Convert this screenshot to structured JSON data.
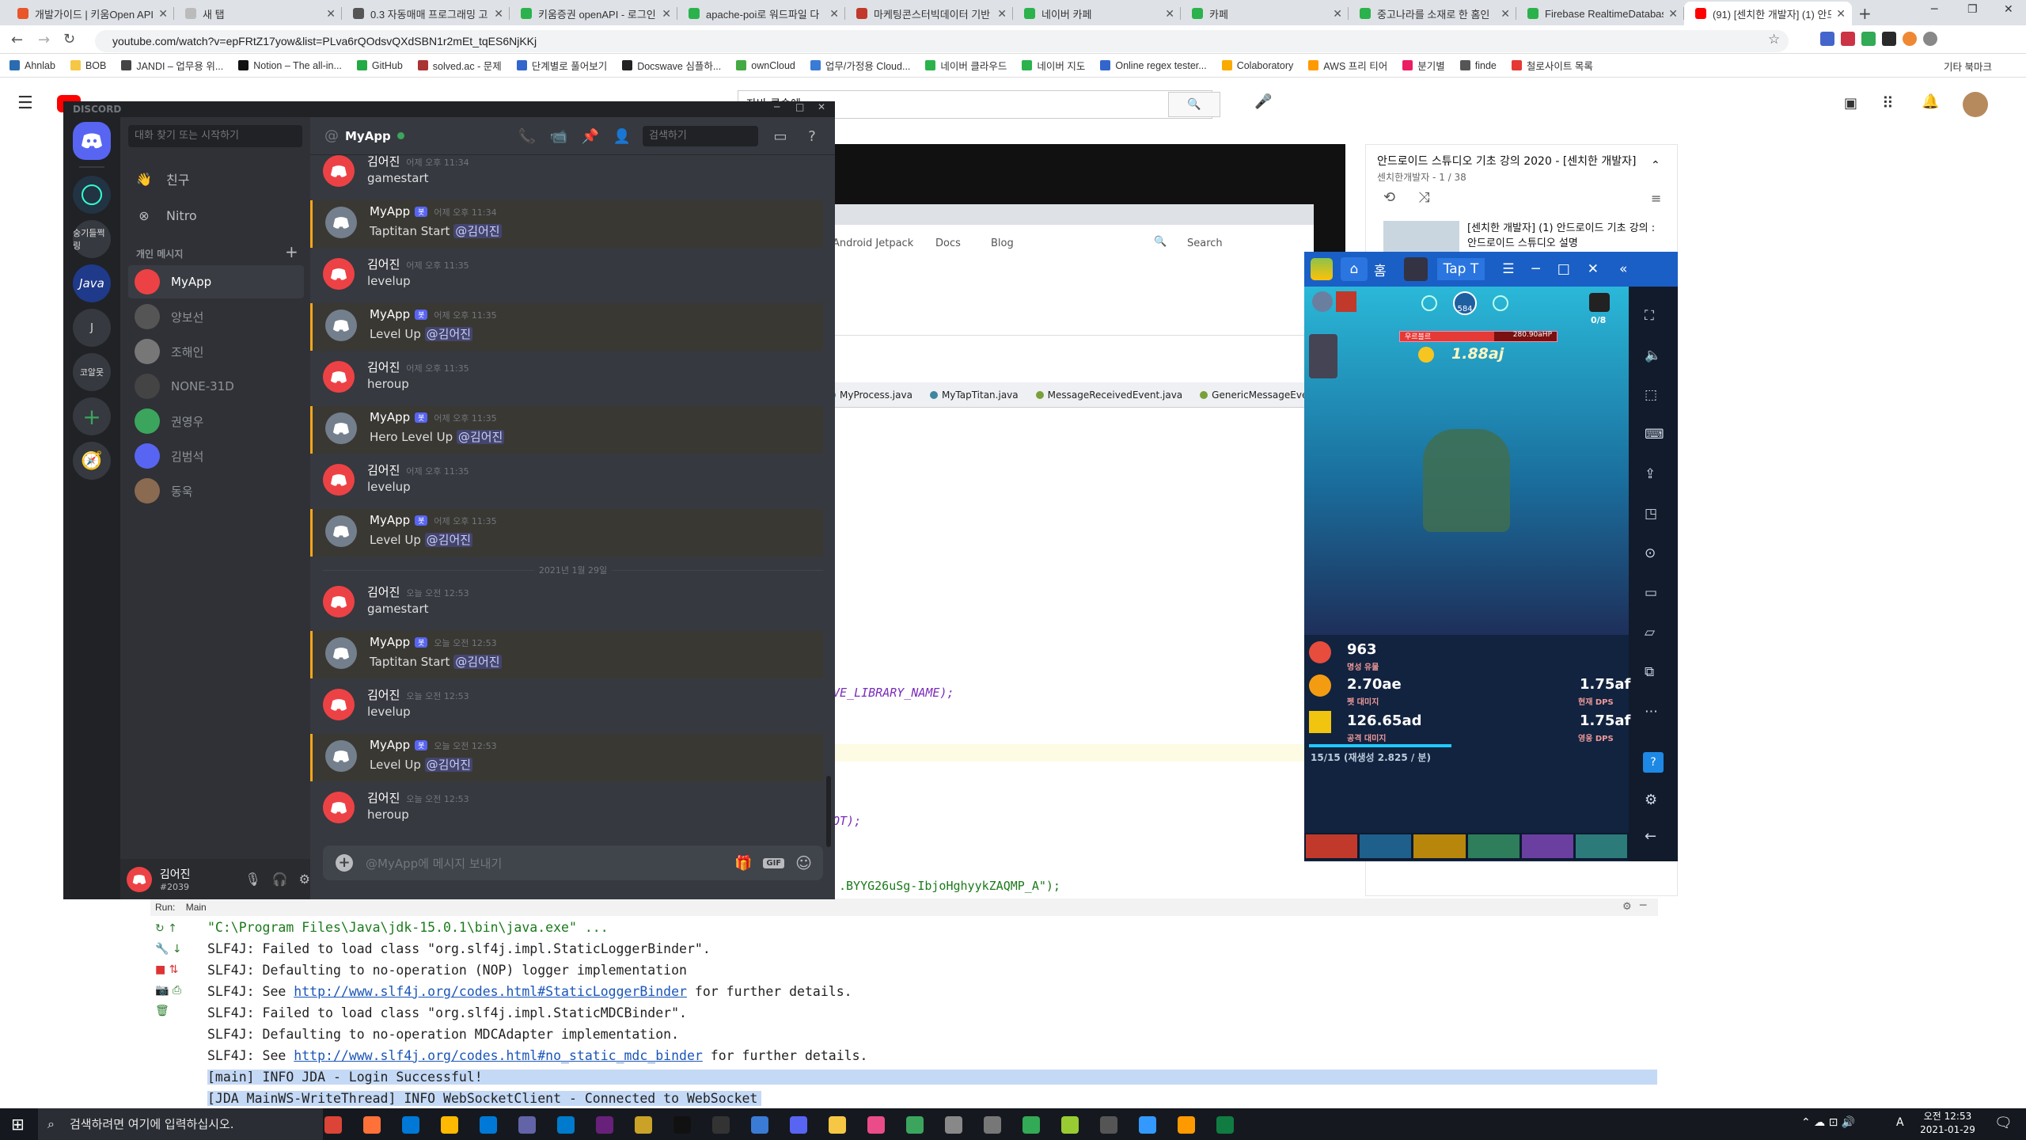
{
  "chrome": {
    "tabs": [
      {
        "title": "개발가이드 | 키움Open API",
        "color": "#e8562a",
        "active": false
      },
      {
        "title": "새 탭",
        "color": "#bbbbbb",
        "active": false
      },
      {
        "title": "0.3 자동매매 프로그래밍 고",
        "color": "#555555",
        "active": false
      },
      {
        "title": "키움증권 openAPI - 로그인",
        "color": "#2bb24c",
        "active": false
      },
      {
        "title": "apache-poi로 워드파일 다",
        "color": "#2bb24c",
        "active": false
      },
      {
        "title": "마케팅콘스터빅데이터 기반",
        "color": "#c0392b",
        "active": false
      },
      {
        "title": "네이버 카페",
        "color": "#2bb24c",
        "active": false
      },
      {
        "title": "카페",
        "color": "#2bb24c",
        "active": false
      },
      {
        "title": "중고나라를 소재로 한 홈인",
        "color": "#2bb24c",
        "active": false
      },
      {
        "title": "Firebase RealtimeDatabase",
        "color": "#2bb24c",
        "active": false
      },
      {
        "title": "(91) [센치한 개발자] (1) 안드",
        "color": "#ff0000",
        "active": true
      }
    ],
    "url": "youtube.com/watch?v=epFRtZ17yow&list=PLva6rQOdsvQXdSBN1r2mEt_tqES6NjKKj",
    "bookmarks": [
      "Ahnlab",
      "BOB",
      "JANDI – 업무용 위...",
      "Notion – The all-in...",
      "GitHub",
      "solved.ac - 문제",
      "단계별로 풀어보기",
      "Docswave 심플하...",
      "ownCloud",
      "업무/가정용 Cloud...",
      "네이버 클라우드",
      "네이버 지도",
      "Online regex tester...",
      "Colaboratory",
      "AWS 프리 티어",
      "분기별",
      "finde",
      "철로사이트 목록"
    ],
    "bookmarks_other": "기타 북마크",
    "youtube_search": "자바 콘솔에"
  },
  "youtube": {
    "playlist_title": "안드로이드 스튜디오 기초 강의 2020 - [센치한 개발자]",
    "playlist_sub": "센치한개발자 - 1 / 38",
    "item1": "[센치한 개발자] (1) 안드로이드 기초 강의 : 안드로이드 스튜디오 설명"
  },
  "web": {
    "links": [
      "Android Jetpack",
      "Docs",
      "Blog"
    ],
    "search": "Search"
  },
  "ide": {
    "tabs": [
      "MyProcess.java",
      "MyTapTitan.java",
      "MessageReceivedEvent.java",
      "GenericMessageEvent.java"
    ],
    "code1": "VE_LIBRARY_NAME);",
    "code2": "OT);",
    "code3": ".BYYG26uSg-IbjoHghyykZAQMP_A\");",
    "run_label": "Run:",
    "run_tab": "Main",
    "console": {
      "l1": "\"C:\\Program Files\\Java\\jdk-15.0.1\\bin\\java.exe\" ...",
      "l2": "SLF4J: Failed to load class \"org.slf4j.impl.StaticLoggerBinder\".",
      "l3": "SLF4J: Defaulting to no-operation (NOP) logger implementation",
      "l4a": "SLF4J: See ",
      "l4link": "http://www.slf4j.org/codes.html#StaticLoggerBinder",
      "l4b": " for further details.",
      "l5": "SLF4J: Failed to load class \"org.slf4j.impl.StaticMDCBinder\".",
      "l6": "SLF4J: Defaulting to no-operation MDCAdapter implementation.",
      "l7a": "SLF4J: See ",
      "l7link": "http://www.slf4j.org/codes.html#no_static_mdc_binder",
      "l7b": " for further details.",
      "l8": "[main] INFO JDA - Login Successful!",
      "l9": "[JDA MainWS-WriteThread] INFO WebSocketClient - Connected to WebSocket"
    }
  },
  "discord": {
    "app_title": "DISCORD",
    "search_placeholder": "대화 찾기 또는 시작하기",
    "nav": {
      "friends": "친구",
      "nitro": "Nitro"
    },
    "dm_header": "개인 메시지",
    "dms": [
      "MyApp",
      "양보선",
      "조해인",
      "NONE-31D",
      "권영우",
      "김범석",
      "동욱"
    ],
    "guild_labels": [
      "숭기들쩍링",
      "J",
      "코알못"
    ],
    "guild_java": "Java",
    "user": {
      "name": "김어진",
      "tag": "#2039"
    },
    "channel_name": "MyApp",
    "channel_search": "검색하기",
    "date_divider": "2021년 1월 29일",
    "bot_tag": "봇",
    "composer_placeholder": "@MyApp에 메시지 보내기",
    "messages": [
      {
        "author": "김어진",
        "time": "어제 오후 11:34",
        "text": "gamestart",
        "bot": false,
        "mention": ""
      },
      {
        "author": "MyApp",
        "time": "어제 오후 11:34",
        "text": "Taptitan Start ",
        "bot": true,
        "mention": "@김어진"
      },
      {
        "author": "김어진",
        "time": "어제 오후 11:35",
        "text": "levelup",
        "bot": false,
        "mention": ""
      },
      {
        "author": "MyApp",
        "time": "어제 오후 11:35",
        "text": "Level Up ",
        "bot": true,
        "mention": "@김어진"
      },
      {
        "author": "김어진",
        "time": "어제 오후 11:35",
        "text": "heroup",
        "bot": false,
        "mention": ""
      },
      {
        "author": "MyApp",
        "time": "어제 오후 11:35",
        "text": "Hero Level Up ",
        "bot": true,
        "mention": "@김어진"
      },
      {
        "author": "김어진",
        "time": "어제 오후 11:35",
        "text": "levelup",
        "bot": false,
        "mention": ""
      },
      {
        "author": "MyApp",
        "time": "어제 오후 11:35",
        "text": "Level Up ",
        "bot": true,
        "mention": "@김어진"
      },
      {
        "author": "김어진",
        "time": "오늘 오전 12:53",
        "text": "gamestart",
        "bot": false,
        "mention": ""
      },
      {
        "author": "MyApp",
        "time": "오늘 오전 12:53",
        "text": "Taptitan Start ",
        "bot": true,
        "mention": "@김어진"
      },
      {
        "author": "김어진",
        "time": "오늘 오전 12:53",
        "text": "levelup",
        "bot": false,
        "mention": ""
      },
      {
        "author": "MyApp",
        "time": "오늘 오전 12:53",
        "text": "Level Up ",
        "bot": true,
        "mention": "@김어진"
      },
      {
        "author": "김어진",
        "time": "오늘 오전 12:53",
        "text": "heroup",
        "bot": false,
        "mention": ""
      }
    ]
  },
  "emulator": {
    "tab_home": "홈",
    "tab_app": "Tap T",
    "game": {
      "stage": "584",
      "boss_hp": "280.90aHP",
      "boss_label": "우르블르",
      "gold": "1.88aj",
      "progress": "0/8",
      "relics": "963",
      "relics_label": "명성 유물",
      "pet_damage": "2.70ae",
      "pet_label": "펫 대미지",
      "current_dps": "1.75af",
      "current_dps_label": "현재 DPS",
      "tap_damage": "126.65ad",
      "tap_label": "공격 대미지",
      "hero_dps": "1.75af",
      "hero_dps_label": "영웅 DPS",
      "mana": "15/15 (재생성 2.825 / 분)"
    }
  },
  "taskbar": {
    "search_placeholder": "검색하려면 여기에 입력하십시오.",
    "time": "오전 12:53",
    "date": "2021-01-29",
    "lang": "A"
  },
  "colors": {
    "discord_bg": "#36393f",
    "discord_blurple": "#5865f2",
    "mention_bar": "#faa61a",
    "youtube_red": "#ff0000"
  }
}
